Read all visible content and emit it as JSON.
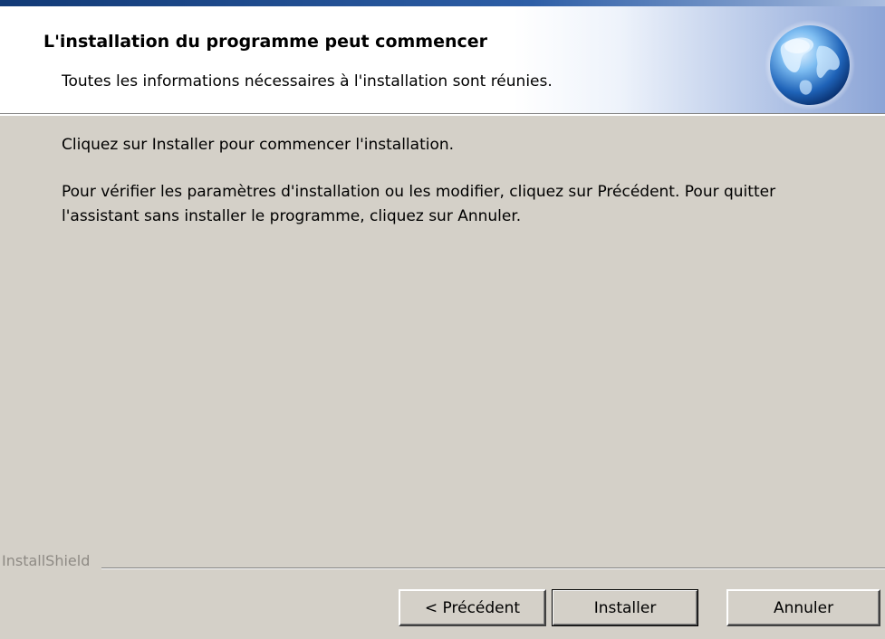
{
  "header": {
    "title": "L'installation du programme peut commencer",
    "subtitle": "Toutes les informations nécessaires à l'installation sont réunies."
  },
  "body": {
    "line1": "Cliquez sur Installer pour commencer l'installation.",
    "line2": "Pour vérifier les paramètres d'installation ou les modifier, cliquez sur Précédent. Pour quitter",
    "line3": "l'assistant sans installer le programme, cliquez sur Annuler."
  },
  "footer": {
    "brand": "InstallShield"
  },
  "buttons": {
    "back": "< Précédent",
    "install": "Installer",
    "cancel": "Annuler"
  },
  "icons": {
    "header_icon": "globe-icon"
  },
  "colors": {
    "dialog_background": "#d4d0c8",
    "header_gradient_end": "#8ba4d6",
    "brand_text": "#8e8a84"
  }
}
